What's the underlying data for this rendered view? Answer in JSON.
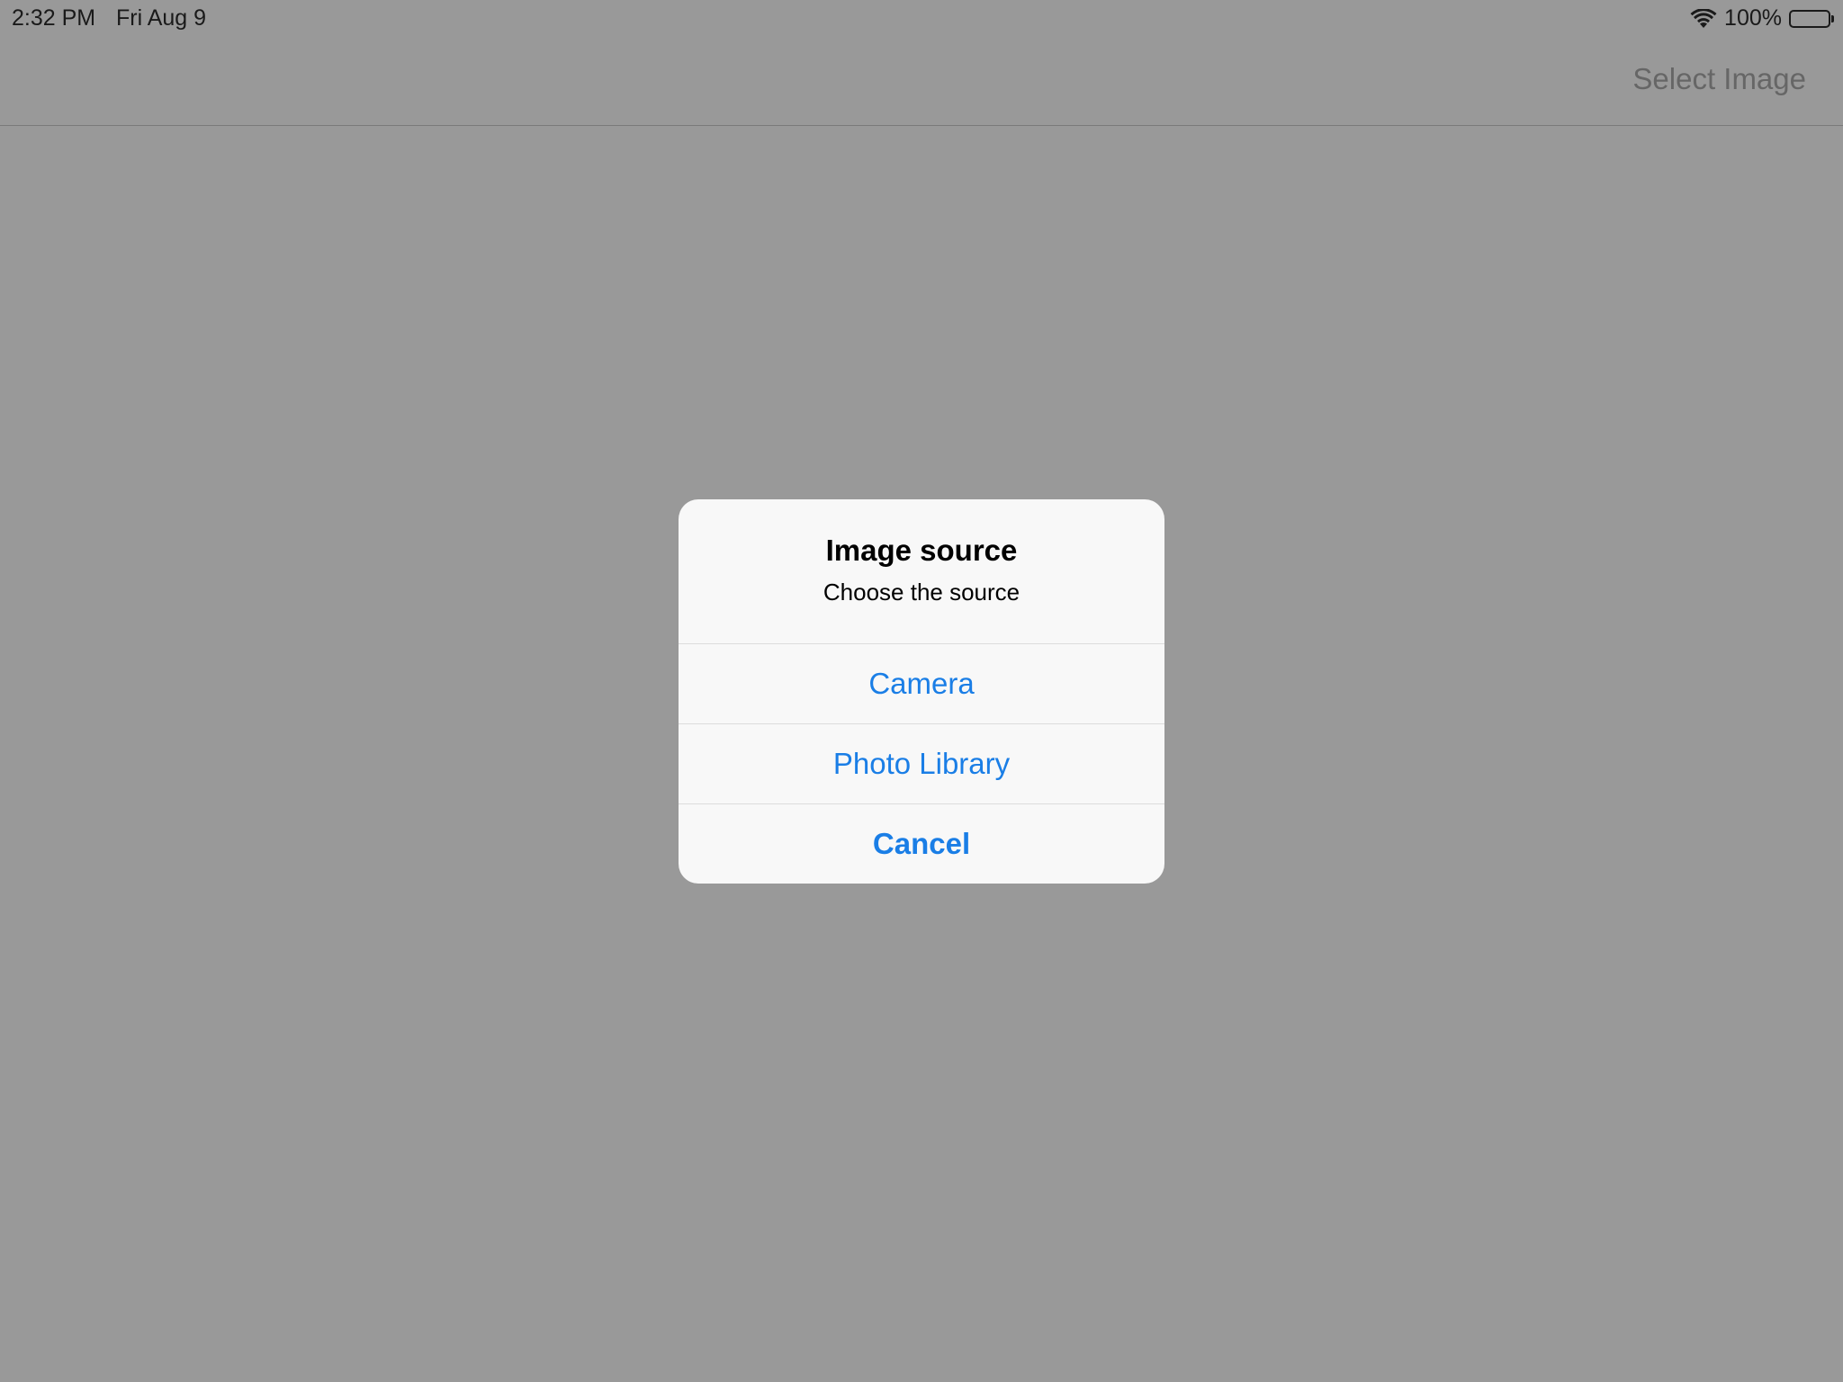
{
  "status_bar": {
    "time": "2:32 PM",
    "date": "Fri Aug 9",
    "battery_percent": "100%",
    "battery_level": 1.0,
    "icons": [
      "wifi-icon",
      "battery-icon"
    ]
  },
  "nav_bar": {
    "action_label": "Select Image"
  },
  "alert": {
    "title": "Image source",
    "message": "Choose the source",
    "actions": [
      {
        "label": "Camera",
        "style": "default"
      },
      {
        "label": "Photo Library",
        "style": "default"
      },
      {
        "label": "Cancel",
        "style": "cancel"
      }
    ]
  },
  "colors": {
    "dimmed_background": "#999999",
    "alert_background": "#f8f8f8",
    "action_tint": "#1a7ee6",
    "nav_action_text": "#666666"
  }
}
